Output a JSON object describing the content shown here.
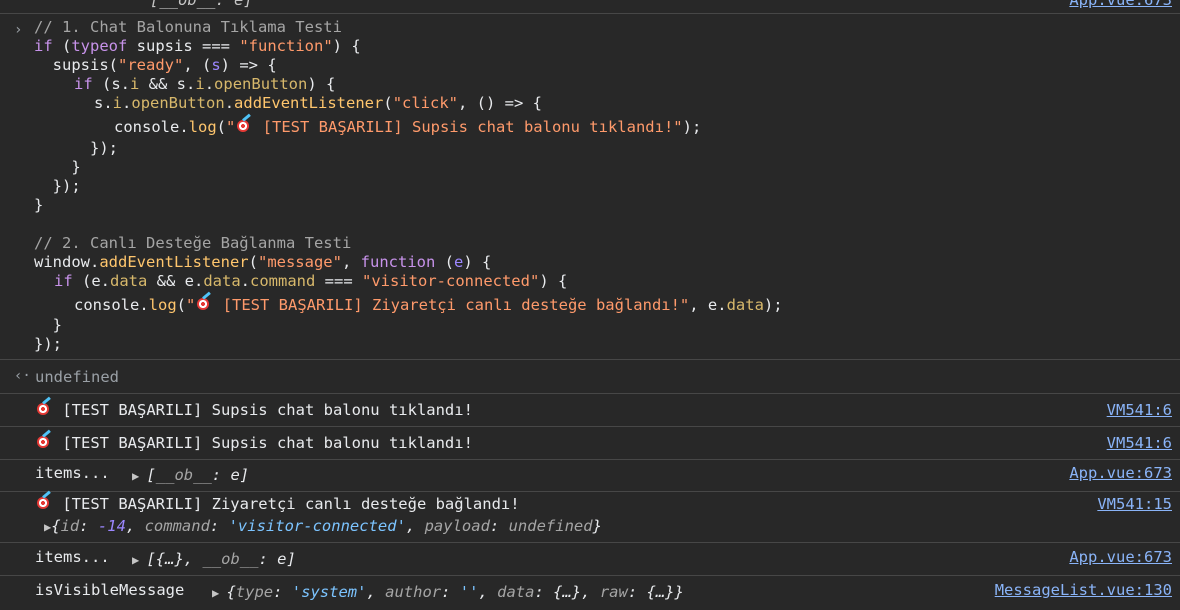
{
  "top_fragment": {
    "text": "[__ob__: e]"
  },
  "top_source": {
    "label": "App.vue:673"
  },
  "code_block": {
    "line1": "// 1. Chat Balonuna Tıklama Testi",
    "line2_kw": "if",
    "line2_a": " (",
    "line2_typeof": "typeof",
    "line2_b": " supsis === ",
    "line2_str": "\"function\"",
    "line2_c": ") {",
    "line3_a": "  supsis(",
    "line3_str": "\"ready\"",
    "line3_b": ", (",
    "line3_s": "s",
    "line3_c": ") => {",
    "line4_kw": "if",
    "line4_a": " (s.",
    "line4_i1": "i",
    "line4_b": " && s.",
    "line4_i2": "i",
    "line4_c": ".",
    "line4_ob": "openButton",
    "line4_d": ") {",
    "line5_a": "s.",
    "line5_i": "i",
    "line5_b": ".",
    "line5_ob": "openButton",
    "line5_c": ".",
    "line5_ael": "addEventListener",
    "line5_d": "(",
    "line5_str": "\"click\"",
    "line5_e": ", () => {",
    "line6_a": "console.",
    "line6_log": "log",
    "line6_b": "(",
    "line6_str1": "\"",
    "line6_str2": " [TEST BAŞARILI] Supsis chat balonu tıklandı!\"",
    "line6_c": ");",
    "line7": "      });",
    "line8": "    }",
    "line9": "  });",
    "line10": "}",
    "line11": "// 2. Canlı Desteğe Bağlanma Testi",
    "line12_a": "window.",
    "line12_ael": "addEventListener",
    "line12_b": "(",
    "line12_str": "\"message\"",
    "line12_c": ", ",
    "line12_fn": "function",
    "line12_d": " (",
    "line12_e": "e",
    "line12_f": ") {",
    "line13_kw": "if",
    "line13_a": " (e.",
    "line13_data1": "data",
    "line13_b": " && e.",
    "line13_data2": "data",
    "line13_c": ".",
    "line13_cmd": "command",
    "line13_d": " === ",
    "line13_str": "\"visitor-connected\"",
    "line13_e": ") {",
    "line14_a": "console.",
    "line14_log": "log",
    "line14_b": "(",
    "line14_str1": "\"",
    "line14_str2": " [TEST BAŞARILI] Ziyaretçi canlı desteğe bağlandı!\"",
    "line14_c": ", e.",
    "line14_data": "data",
    "line14_d": ");",
    "line15": "  }",
    "line16": "});"
  },
  "result": {
    "text": "undefined"
  },
  "logs": [
    {
      "text": " [TEST BAŞARILI] Supsis chat balonu tıklandı!",
      "source": "VM541:6"
    },
    {
      "text": " [TEST BAŞARILI] Supsis chat balonu tıklandı!",
      "source": "VM541:6"
    },
    {
      "label": "items...",
      "obj_a": "[",
      "obj_key": "__ob__",
      "obj_b": ": e]",
      "source": "App.vue:673"
    },
    {
      "text": " [TEST BAŞARILI] Ziyaretçi canlı desteğe bağlandı!",
      "source": "VM541:15",
      "obj": {
        "open": "{",
        "k1": "id",
        "c1": ": ",
        "v1": "-14",
        "s1": ", ",
        "k2": "command",
        "c2": ": ",
        "v2": "'visitor-connected'",
        "s2": ", ",
        "k3": "payload",
        "c3": ": ",
        "v3": "undefined",
        "close": "}"
      }
    },
    {
      "label": "items...",
      "obj_a": "[{…}, ",
      "obj_key": "__ob__",
      "obj_b": ": e]",
      "source": "App.vue:673"
    },
    {
      "label": "isVisibleMessage",
      "source": "MessageList.vue:130",
      "obj": {
        "open": "{",
        "k1": "type",
        "c1": ": ",
        "v1": "'system'",
        "s1": ", ",
        "k2": "author",
        "c2": ": ",
        "v2": "''",
        "s2": ", ",
        "k3": "data",
        "c3": ": ",
        "v3": "{…}",
        "s3": ", ",
        "k4": "raw",
        "c4": ": ",
        "v4": "{…}",
        "close": "}"
      }
    }
  ],
  "icons": {
    "expand": "chevron-right-icon",
    "result": "return-arrow-icon",
    "emoji": "direct-hit-icon",
    "expander": "triangle-right-icon"
  },
  "colors": {
    "background": "#282828",
    "link": "#8ab4f8",
    "string": "#ff9a6b",
    "keyword": "#c792ea"
  }
}
